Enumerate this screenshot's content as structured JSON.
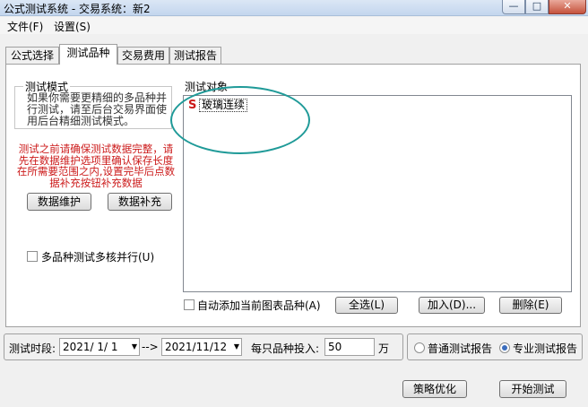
{
  "window": {
    "title": "公式测试系统 - 交易系统：新2",
    "min_glyph": "—",
    "max_glyph": "□",
    "close_glyph": "✕"
  },
  "menu": {
    "file": "文件(F)",
    "settings": "设置(S)"
  },
  "tabs": [
    {
      "label": "公式选择"
    },
    {
      "label": "测试品种"
    },
    {
      "label": "交易费用"
    },
    {
      "label": "测试报告"
    }
  ],
  "test_mode": {
    "legend": "测试模式",
    "description": "如果你需要更精细的多品种并行测试，请至后台交易界面使用后台精细测试模式。"
  },
  "warning": "测试之前请确保测试数据完整，请先在数据维护选项里确认保存长度在所需要范围之内,设置完毕后点数据补充按钮补充数据",
  "buttons": {
    "data_maintain": "数据维护",
    "data_supplement": "数据补充",
    "select_all": "全选(L)",
    "add": "加入(D)...",
    "delete": "删除(E)",
    "optimize": "策略优化",
    "start_test": "开始测试"
  },
  "multicore_label": "多品种测试多核并行(U)",
  "test_objects": {
    "label": "测试对象",
    "items": [
      {
        "mark": "S",
        "name": "玻璃连续"
      }
    ]
  },
  "auto_add_label": "自动添加当前图表品种(A)",
  "period": {
    "label": "测试时段:",
    "start": "2021/ 1/ 1",
    "arrow": "-->",
    "end": "2021/11/12",
    "dropdown_glyph": "▼"
  },
  "investment": {
    "label": "每只品种投入:",
    "value": "50",
    "unit": "万"
  },
  "report": {
    "normal": "普通测试报告",
    "pro": "专业测试报告",
    "selected": "pro"
  }
}
